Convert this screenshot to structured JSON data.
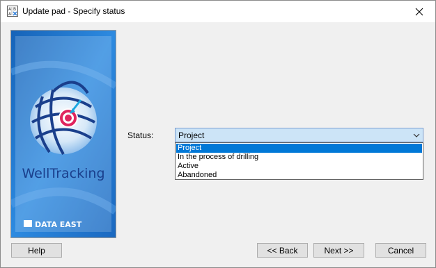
{
  "window": {
    "title": "Update pad - Specify status"
  },
  "banner": {
    "product": "WellTracking",
    "company": "DATA EAST"
  },
  "form": {
    "status_label": "Status:",
    "status_value": "Project",
    "options": [
      "Project",
      "In the process of drilling",
      "Active",
      "Abandoned"
    ],
    "selected_index": 0
  },
  "buttons": {
    "help": "Help",
    "back": "<< Back",
    "next": "Next >>",
    "cancel": "Cancel"
  },
  "colors": {
    "selection": "#0078d7",
    "combo_focus": "#cce4f7",
    "banner_bg": "#1a6fc2",
    "accent": "#e0245e"
  },
  "icons": {
    "app": "application-icon",
    "close": "close-icon",
    "dropdown": "chevron-down-icon"
  }
}
